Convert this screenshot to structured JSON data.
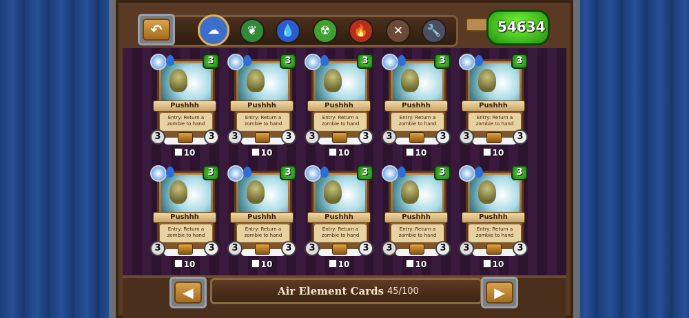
{
  "header": {
    "currency_value": "54634",
    "back_icon": "back-arrow-icon"
  },
  "element_tabs": [
    {
      "name": "air",
      "icon": "cloud",
      "color": "#3c6fc9",
      "active": true
    },
    {
      "name": "earth",
      "icon": "leaf",
      "color": "#2f8a3a",
      "active": false
    },
    {
      "name": "water",
      "icon": "drop",
      "color": "#2a5bd0",
      "active": false
    },
    {
      "name": "toxic",
      "icon": "radiation",
      "color": "#3fa12f",
      "active": false
    },
    {
      "name": "fire",
      "icon": "flame",
      "color": "#b3301f",
      "active": false
    },
    {
      "name": "bones",
      "icon": "bone",
      "color": "#6b4a3a",
      "active": false
    },
    {
      "name": "tools",
      "icon": "wrench",
      "color": "#4a4f62",
      "active": false
    }
  ],
  "cards": [
    {
      "name": "Pushhh",
      "description": "Entry: Return a zombie to hand",
      "cost": "3",
      "attack": "3",
      "health": "3",
      "count": "10"
    },
    {
      "name": "Pushhh",
      "description": "Entry: Return a zombie to hand",
      "cost": "3",
      "attack": "3",
      "health": "3",
      "count": "10"
    },
    {
      "name": "Pushhh",
      "description": "Entry: Return a zombie to hand",
      "cost": "3",
      "attack": "3",
      "health": "3",
      "count": "10"
    },
    {
      "name": "Pushhh",
      "description": "Entry: Return a zombie to hand",
      "cost": "3",
      "attack": "3",
      "health": "3",
      "count": "10"
    },
    {
      "name": "Pushhh",
      "description": "Entry: Return a zombie to hand",
      "cost": "3",
      "attack": "3",
      "health": "3",
      "count": "10"
    },
    {
      "name": "Pushhh",
      "description": "Entry: Return a zombie to hand",
      "cost": "3",
      "attack": "3",
      "health": "3",
      "count": "10"
    },
    {
      "name": "Pushhh",
      "description": "Entry: Return a zombie to hand",
      "cost": "3",
      "attack": "3",
      "health": "3",
      "count": "10"
    },
    {
      "name": "Pushhh",
      "description": "Entry: Return a zombie to hand",
      "cost": "3",
      "attack": "3",
      "health": "3",
      "count": "10"
    },
    {
      "name": "Pushhh",
      "description": "Entry: Return a zombie to hand",
      "cost": "3",
      "attack": "3",
      "health": "3",
      "count": "10"
    },
    {
      "name": "Pushhh",
      "description": "Entry: Return a zombie to hand",
      "cost": "3",
      "attack": "3",
      "health": "3",
      "count": "10"
    }
  ],
  "footer": {
    "title": "Air Element Cards",
    "page_count": "45/100",
    "prev_label": "◀",
    "next_label": "▶"
  },
  "tab_glyphs": [
    "☁",
    "❦",
    "💧",
    "☢",
    "🔥",
    "✕",
    "🔧"
  ]
}
